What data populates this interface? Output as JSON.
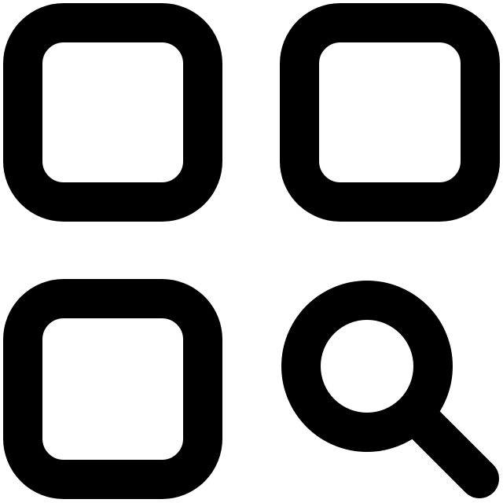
{
  "icon": {
    "name": "app-search-icon",
    "description_visible": "",
    "stroke_color": "#000000",
    "background_color": "#ffffff",
    "parts": [
      {
        "name": "grid-square-top-left-icon"
      },
      {
        "name": "grid-square-top-right-icon"
      },
      {
        "name": "grid-square-bottom-left-icon"
      },
      {
        "name": "magnifier-icon"
      }
    ]
  }
}
